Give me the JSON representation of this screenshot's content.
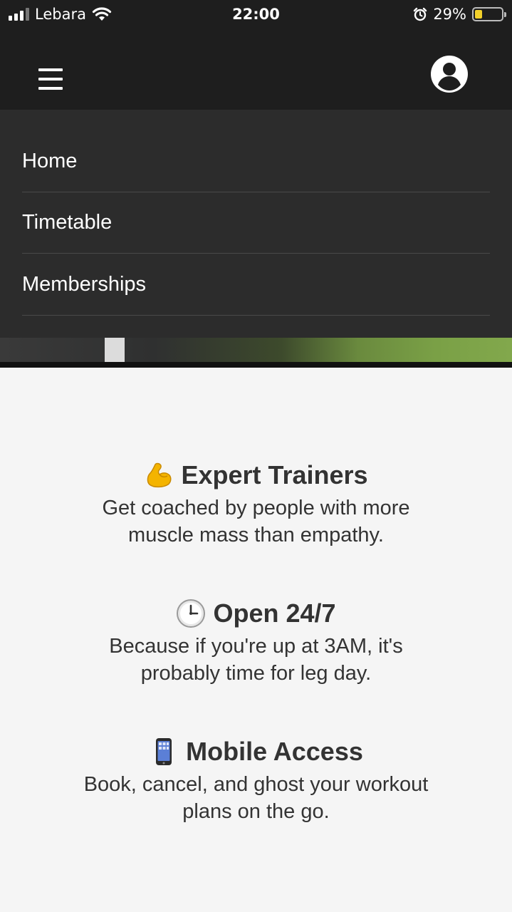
{
  "status_bar": {
    "carrier": "Lebara",
    "time": "22:00",
    "battery_percent": "29%",
    "battery_level": 0.29,
    "icons": [
      "signal-icon",
      "wifi-icon",
      "alarm-icon",
      "battery-icon"
    ]
  },
  "header": {
    "menu_icon": "hamburger-menu-icon",
    "account_icon": "user-account-icon"
  },
  "nav": {
    "items": [
      {
        "label": "Home"
      },
      {
        "label": "Timetable"
      },
      {
        "label": "Memberships"
      }
    ]
  },
  "features": [
    {
      "icon": "flexed-biceps-emoji",
      "title": "Expert Trainers",
      "lines": [
        "Get coached by people with more",
        "muscle mass than empathy."
      ]
    },
    {
      "icon": "clock-emoji",
      "title": "Open 24/7",
      "lines": [
        "Because if you're up at 3AM, it's",
        "probably time for leg day."
      ]
    },
    {
      "icon": "mobile-phone-emoji",
      "title": "Mobile Access",
      "lines": [
        "Book, cancel, and ghost your workout",
        "plans on the go."
      ]
    }
  ],
  "colors": {
    "header_bg": "#1e1e1e",
    "menu_bg": "#2c2c2c",
    "divider": "#4a4a4a",
    "page_bg": "#f5f5f5",
    "text": "#333333"
  }
}
